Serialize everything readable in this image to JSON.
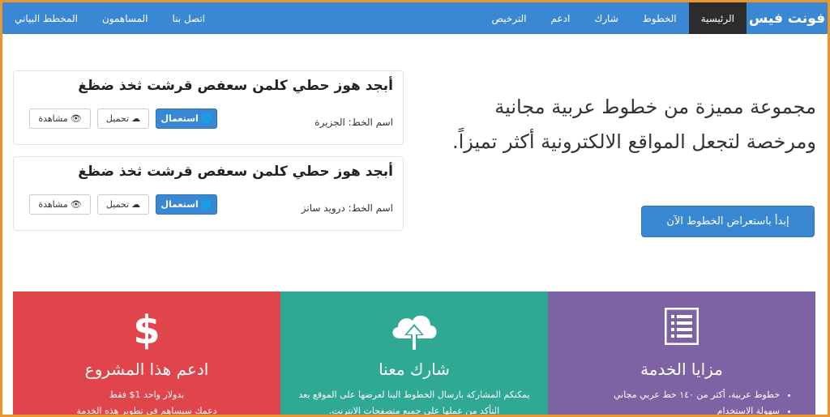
{
  "navbar": {
    "brand": "فونت فيس",
    "items": [
      {
        "label": "الرئيسية"
      },
      {
        "label": "الخطوط"
      },
      {
        "label": "شارك"
      },
      {
        "label": "ادعم"
      },
      {
        "label": "الترخيص"
      }
    ],
    "left_items": [
      {
        "label": "اتصل بنا"
      },
      {
        "label": "المساهمون"
      },
      {
        "label": "المخطط البياني"
      }
    ]
  },
  "hero": {
    "text": "مجموعة مميزة من خطوط عربية مجانية ومرخصة لتجعل المواقع الالكترونية أكثر تميزاً.",
    "cta_label": "إبدأ باستعراض الخطوط الآن"
  },
  "fonts": [
    {
      "sample": "أبجد هوز حطي كلمن سعفص قرشت ثخذ ضظغ",
      "name_label": "اسم الخط:",
      "name": "الجزيرة",
      "use_label": "استعمال",
      "download_label": "تحميل",
      "view_label": "مشاهدة"
    },
    {
      "sample": "أبجد هوز حطي كلمن سعفص قرشت ثخذ ضظغ",
      "name_label": "اسم الخط:",
      "name": "درويد سانز",
      "use_label": "استعمال",
      "download_label": "تحميل",
      "view_label": "مشاهدة"
    }
  ],
  "panels": {
    "features": {
      "title": "مزايا الخدمة",
      "items": [
        "خطوط عربية، أكثر من ١٤٠ خط عربي مجاني",
        "سهولة الاستخدام"
      ]
    },
    "share": {
      "title": "شارك معنا",
      "body": "يمكنكم المشاركة بارسال الخطوط الينا لعرضها على الموقع بعد التأكد من عملها على جميع متصفحات الانترنت."
    },
    "support": {
      "title": "ادعم هذا المشروع",
      "line1": "بدولار واحد 1$ فقط",
      "line2": "دعمك سيساهم في تطوير هذه الخدمة"
    }
  },
  "colors": {
    "primary": "#3a87d4",
    "red": "#e0454b",
    "teal": "#2fa894",
    "purple": "#7d63a4",
    "border": "#e8962e"
  }
}
